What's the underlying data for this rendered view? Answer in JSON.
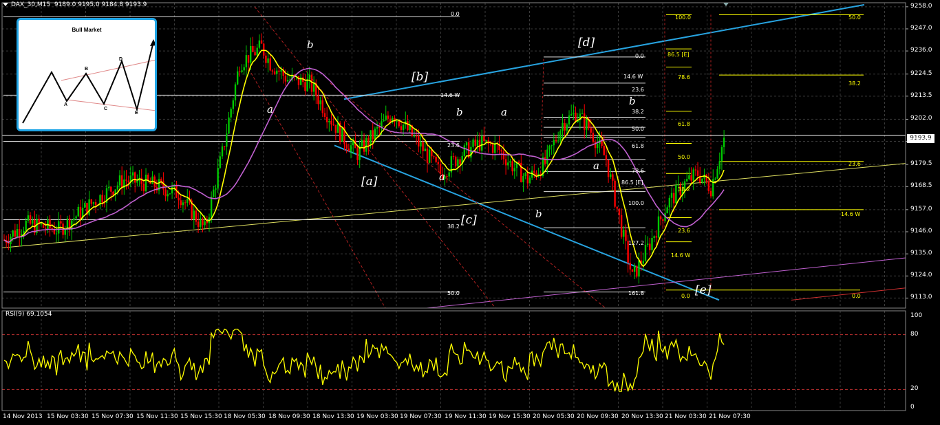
{
  "header": {
    "symbol": "DAX_30,M15",
    "ohlc": "9189.0 9195.0 9184.8 9193.9"
  },
  "rsi_header": "RSI(9) 69.1054",
  "current_price": "9193.9",
  "inset": {
    "title": "Bull Market",
    "labels": [
      "A",
      "B",
      "C",
      "D",
      "E"
    ]
  },
  "wave_labels": [
    "b",
    "a",
    "[b]",
    "b",
    "a",
    "[a]",
    "a",
    "[c]",
    "b",
    "[d]",
    "b",
    "a",
    "[e]"
  ],
  "fib_labels": {
    "white": [
      "0.0",
      "14.6 W",
      "38.2",
      "50.0",
      "0.0",
      "14.6 W",
      "23.6",
      "38.2",
      "50.0",
      "61.8",
      "78.6",
      "86.5 [E]",
      "100.0",
      "127.2",
      "161.8",
      "23.6"
    ],
    "yellow": [
      "100.0",
      "50.0",
      "86.5 [E]",
      "78.6",
      "38.2",
      "61.8",
      "50.0",
      "23.6",
      "38.2",
      "23.6",
      "14.6 W",
      "14.6 W",
      "0.0",
      "0.0"
    ]
  },
  "colors": {
    "background": "#000000",
    "grid": "#3a3a3a",
    "bull_candle": "#00c800",
    "bear_candle": "#ff0000",
    "ma_fast": "#ffff00",
    "ma_slow": "#c060d0",
    "trend_channel": "#27a3e0",
    "rsi_line": "#ffff00",
    "fib_level": "#ffff00"
  },
  "chart_data": [
    {
      "type": "candlestick",
      "title": "DAX_30,M15",
      "ylim": [
        9108,
        9260
      ],
      "y_ticks": [
        "9258.0",
        "9247.0",
        "9236.0",
        "9224.5",
        "9213.5",
        "9202.0",
        "9191.0",
        "9179.5",
        "9168.5",
        "9157.0",
        "9146.0",
        "9135.0",
        "9124.0",
        "9113.0"
      ],
      "x_ticks": [
        "14 Nov 2013",
        "15 Nov 03:30",
        "15 Nov 07:30",
        "15 Nov 11:30",
        "15 Nov 15:30",
        "18 Nov 05:30",
        "18 Nov 09:30",
        "18 Nov 13:30",
        "19 Nov 03:30",
        "19 Nov 07:30",
        "19 Nov 11:30",
        "19 Nov 15:30",
        "20 Nov 05:30",
        "20 Nov 09:30",
        "20 Nov 13:30",
        "21 Nov 03:30",
        "21 Nov 07:30"
      ],
      "close_path": [
        [
          0,
          9142
        ],
        [
          10,
          9150
        ],
        [
          25,
          9147
        ],
        [
          40,
          9160
        ],
        [
          55,
          9172
        ],
        [
          70,
          9169
        ],
        [
          80,
          9165
        ],
        [
          92,
          9147
        ],
        [
          100,
          9185
        ],
        [
          108,
          9230
        ],
        [
          118,
          9238
        ],
        [
          122,
          9230
        ],
        [
          130,
          9222
        ],
        [
          140,
          9220
        ],
        [
          148,
          9205
        ],
        [
          156,
          9192
        ],
        [
          162,
          9185
        ],
        [
          170,
          9195
        ],
        [
          178,
          9205
        ],
        [
          184,
          9198
        ],
        [
          192,
          9187
        ],
        [
          200,
          9175
        ],
        [
          210,
          9185
        ],
        [
          218,
          9190
        ],
        [
          226,
          9188
        ],
        [
          232,
          9180
        ],
        [
          240,
          9172
        ],
        [
          248,
          9180
        ],
        [
          256,
          9200
        ],
        [
          262,
          9205
        ],
        [
          268,
          9198
        ],
        [
          276,
          9182
        ],
        [
          288,
          9123
        ],
        [
          296,
          9140
        ],
        [
          304,
          9160
        ],
        [
          312,
          9170
        ],
        [
          318,
          9175
        ],
        [
          324,
          9168
        ],
        [
          330,
          9192
        ]
      ],
      "series": [
        {
          "name": "MA fast",
          "values_ref": "close_path"
        },
        {
          "name": "MA slow",
          "values_ref": "close_path"
        }
      ]
    },
    {
      "type": "line",
      "title": "RSI(9) 69.1054",
      "ylim": [
        0,
        100
      ],
      "y_ticks": [
        "100",
        "80",
        "20",
        "0"
      ],
      "levels": [
        80,
        20
      ],
      "last_value": 69.1054
    }
  ]
}
